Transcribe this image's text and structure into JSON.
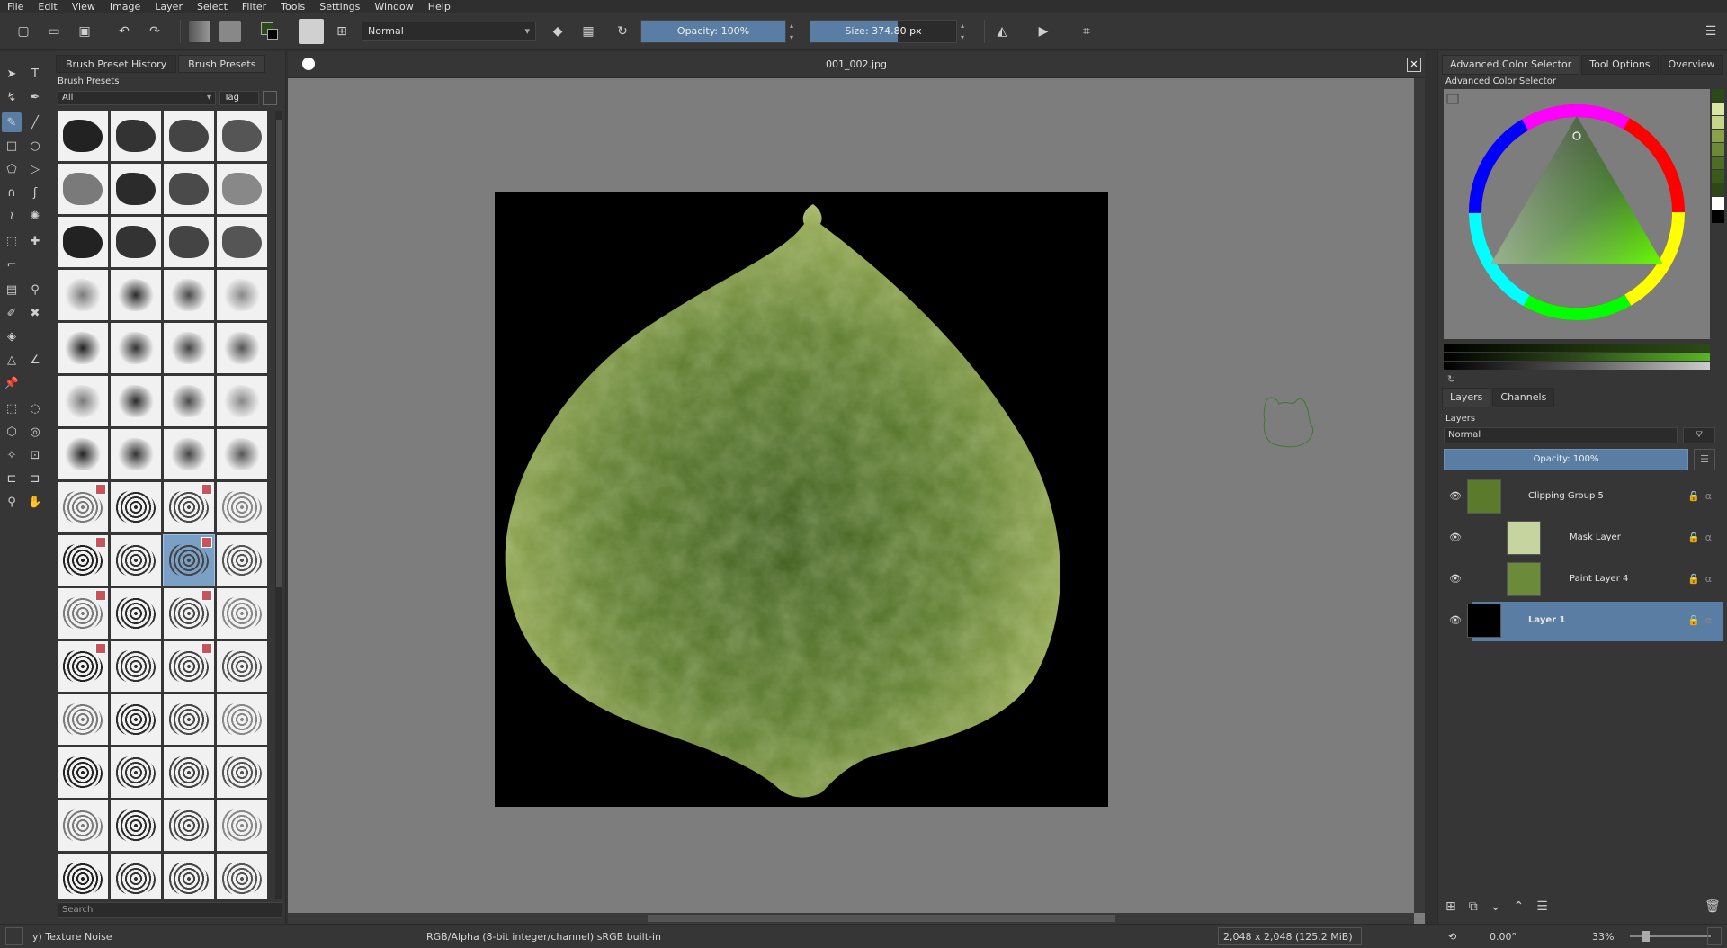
{
  "menu": [
    "File",
    "Edit",
    "View",
    "Image",
    "Layer",
    "Select",
    "Filter",
    "Tools",
    "Settings",
    "Window",
    "Help"
  ],
  "toolbar": {
    "blend_mode": "Normal",
    "opacity_label": "Opacity: 100%",
    "opacity_value": 1.0,
    "size_label": "Size: 374.80 px"
  },
  "brush_docker": {
    "tabs": [
      "Brush Preset History",
      "Brush Presets"
    ],
    "active_tab": "Brush Presets",
    "title": "Brush Presets",
    "filter": "All",
    "tag_label": "Tag",
    "search_placeholder": "Search"
  },
  "document": {
    "title": "001_002.jpg"
  },
  "color_docker": {
    "tabs": [
      "Advanced Color Selector",
      "Tool Options",
      "Overview"
    ],
    "title": "Advanced Color Selector",
    "swatches": [
      "#2c4a17",
      "#d9e8a0",
      "#c5d68a",
      "#8aa04a",
      "#6c8a35",
      "#4d6d25",
      "#3a5a1c",
      "#2d4716",
      "#ffffff",
      "#000000"
    ]
  },
  "layers_docker": {
    "tabs": [
      "Layers",
      "Channels"
    ],
    "title": "Layers",
    "blend_mode": "Normal",
    "opacity_label": "Opacity:  100%",
    "layers": [
      {
        "name": "Clipping Group 5"
      },
      {
        "name": "Mask Layer"
      },
      {
        "name": "Paint Layer 4"
      },
      {
        "name": "Layer 1"
      }
    ]
  },
  "status": {
    "brush": "y) Texture Noise",
    "colorspace": "RGB/Alpha (8-bit integer/channel)  sRGB built-in",
    "image_size": "2,048 x 2,048 (125.2 MiB)",
    "rotation": "0.00°",
    "zoom": "33%"
  }
}
